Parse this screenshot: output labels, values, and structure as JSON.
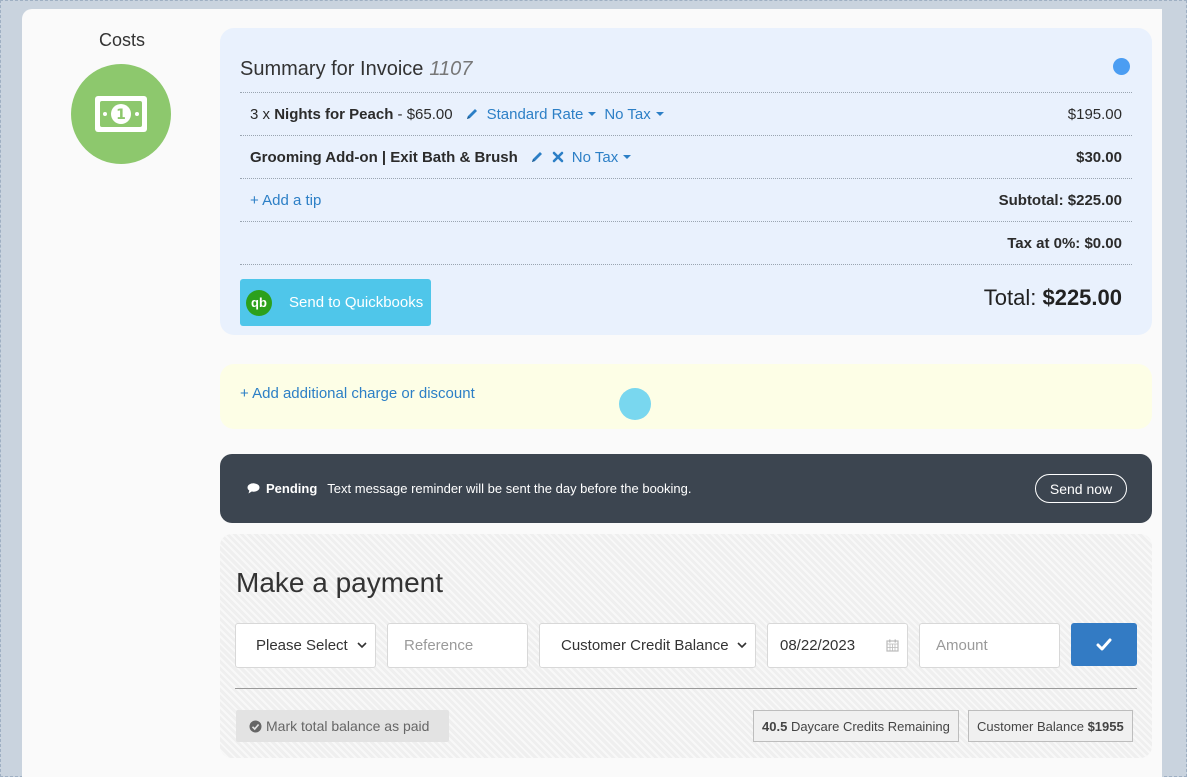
{
  "left": {
    "costs_title": "Costs",
    "costs_icon": "money-bill-icon",
    "accent_color": "#8dc86d"
  },
  "summary": {
    "title": "Summary for Invoice",
    "invoice_number": "1107",
    "line1": {
      "qty_prefix": "3 x",
      "name": "Nights for Peach",
      "unit_price": "- $65.00",
      "rate": "Standard Rate",
      "tax": "No Tax",
      "amount": "$195.00"
    },
    "line2": {
      "name": "Grooming Add-on | Exit Bath & Brush",
      "tax": "No Tax",
      "amount": "$30.00"
    },
    "add_tip": "+ Add a tip",
    "subtotal": "Subtotal: $225.00",
    "tax_line": "Tax at 0%: $0.00",
    "quickbooks_label": "Send to Quickbooks",
    "quickbooks_logo": "qb",
    "total_label": "Total:",
    "total_amount": "$225.00"
  },
  "add_charge": {
    "label": "+ Add additional charge or discount"
  },
  "pending": {
    "label": "Pending",
    "message": "Text message reminder will be sent the day before the booking.",
    "send_now": "Send now"
  },
  "payment": {
    "title": "Make a payment",
    "method_select": "Please Select",
    "reference_placeholder": "Reference",
    "source_select": "Customer Credit Balance",
    "date_value": "08/22/2023",
    "amount_placeholder": "Amount",
    "mark_paid": "Mark total balance as paid",
    "credits_value": "40.5",
    "credits_label": "Daycare Credits Remaining",
    "balance_label": "Customer Balance",
    "balance_value": "$1955"
  }
}
